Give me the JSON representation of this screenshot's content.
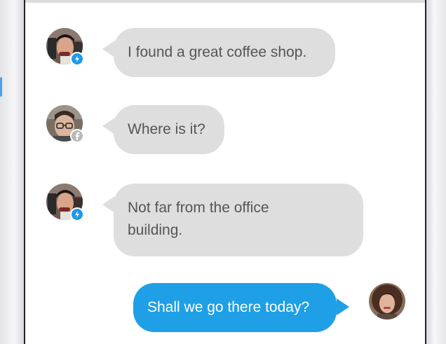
{
  "conversation": {
    "messages": [
      {
        "sender_avatar": "man-dark-hair-avatar",
        "badge": "messenger-icon",
        "direction": "incoming",
        "text": "I found a great coffee shop."
      },
      {
        "sender_avatar": "man-glasses-avatar",
        "badge": "facebook-icon",
        "direction": "incoming",
        "text": "Where is it?"
      },
      {
        "sender_avatar": "man-dark-hair-avatar",
        "badge": "messenger-icon",
        "direction": "incoming",
        "text": "Not far from the office building."
      },
      {
        "sender_avatar": "woman-curly-hair-avatar",
        "badge": "",
        "direction": "outgoing",
        "text": "Shall we go there today?"
      }
    ]
  },
  "colors": {
    "incoming_bubble": "#dedede",
    "incoming_text": "#555555",
    "outgoing_bubble": "#1e9fe6",
    "outgoing_text": "#ffffff",
    "messenger_badge": "#1e9be8",
    "facebook_badge": "#b9b9b9"
  }
}
